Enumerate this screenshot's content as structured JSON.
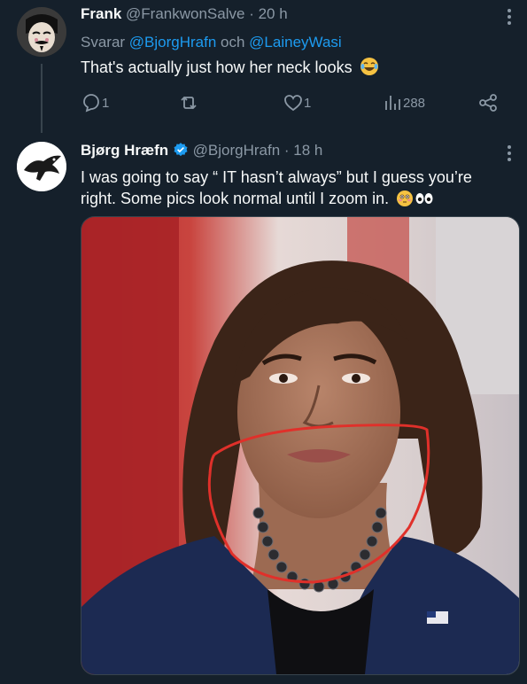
{
  "tweet1": {
    "name": "Frank",
    "handle": "@FrankwonSalve",
    "time": "· 20 h",
    "reply_prefix": "Svarar ",
    "reply_to_1": "@BjorgHrafn",
    "reply_joiner": " och ",
    "reply_to_2": "@LaineyWasi",
    "text": "That's actually just how her neck looks",
    "emoji": "laughing-face-icon",
    "actions": {
      "replies": "1",
      "retweets": "",
      "likes": "1",
      "views": "288"
    }
  },
  "tweet2": {
    "name": "Bjørg Hræfn",
    "handle": "@BjorgHrafn",
    "time": "· 18 h",
    "text_line1": "I was going to say “ IT hasn’t always” but I guess you’re",
    "text_line2": "right. Some pics look normal until I zoom in.",
    "emoji": "flushed-face-and-eyes-icon",
    "media": "photo-woman-with-red-circle-annotation"
  },
  "colors": {
    "background": "#15202b",
    "text": "#f7f9f9",
    "secondary": "#8b98a5",
    "accent": "#1d9bf0",
    "annotation": "#e0302a"
  }
}
